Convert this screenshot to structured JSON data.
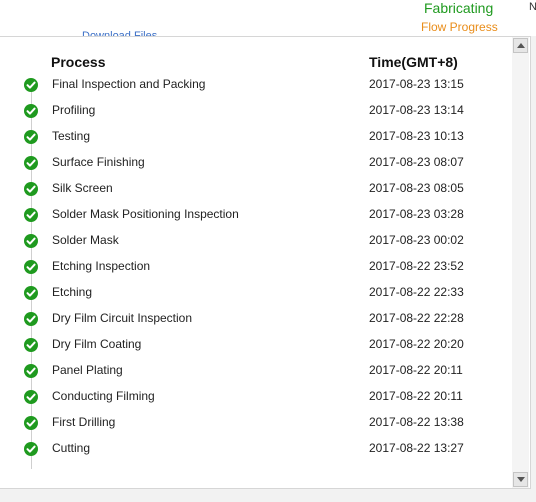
{
  "header": {
    "status": "Fabricating",
    "flow_label": "Flow Progress",
    "corner_letter": "N",
    "ghost_link": "Download Files"
  },
  "table": {
    "col_process": "Process",
    "col_time": "Time(GMT+8)",
    "rows": [
      {
        "process": "Final Inspection and Packing",
        "time": "2017-08-23 13:15"
      },
      {
        "process": "Profiling",
        "time": "2017-08-23 13:14"
      },
      {
        "process": "Testing",
        "time": "2017-08-23 10:13"
      },
      {
        "process": "Surface Finishing",
        "time": "2017-08-23 08:07"
      },
      {
        "process": "Silk Screen",
        "time": "2017-08-23 08:05"
      },
      {
        "process": "Solder Mask Positioning Inspection",
        "time": "2017-08-23 03:28"
      },
      {
        "process": "Solder Mask",
        "time": "2017-08-23 00:02"
      },
      {
        "process": "Etching Inspection",
        "time": "2017-08-22 23:52"
      },
      {
        "process": "Etching",
        "time": "2017-08-22 22:33"
      },
      {
        "process": "Dry Film Circuit Inspection",
        "time": "2017-08-22 22:28"
      },
      {
        "process": "Dry Film Coating",
        "time": "2017-08-22 20:20"
      },
      {
        "process": "Panel Plating",
        "time": "2017-08-22 20:11"
      },
      {
        "process": "Conducting Filming",
        "time": "2017-08-22 20:11"
      },
      {
        "process": "First Drilling",
        "time": "2017-08-22 13:38"
      },
      {
        "process": "Cutting",
        "time": "2017-08-22 13:27"
      }
    ]
  },
  "colors": {
    "status": "#1f9a1f",
    "flow": "#e98d1a",
    "check": "#1f9a1f"
  },
  "icons": {
    "row_icon": "check-circle-icon"
  }
}
